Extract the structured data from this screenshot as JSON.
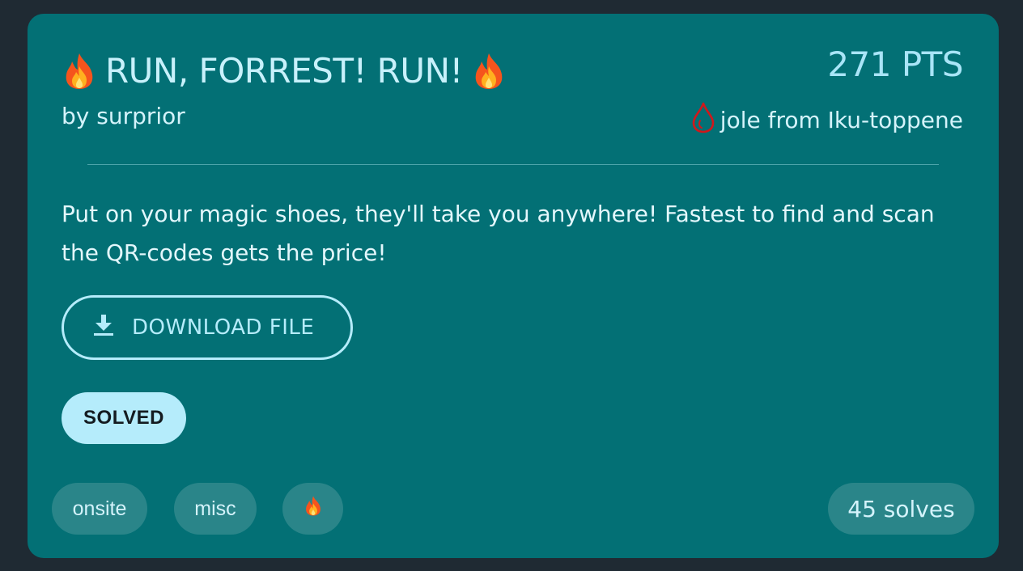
{
  "challenge": {
    "title": "RUN, FORREST! RUN!",
    "title_icon": "fire-icon",
    "author": "by surprior",
    "points": "271 PTS",
    "first_blood": {
      "icon": "blood-drop-icon",
      "text": "jole from Iku-toppene"
    },
    "description": "Put on your magic shoes, they'll take you anywhere! Fastest to find and scan the QR-codes gets the price!",
    "download_label": "DOWNLOAD FILE",
    "status_badge": "SOLVED",
    "tags": [
      {
        "label": "onsite"
      },
      {
        "label": "misc"
      },
      {
        "label": "",
        "icon": "fire-icon"
      }
    ],
    "solves": "45 solves"
  },
  "colors": {
    "page_background": "#1f2a33",
    "card_background": "#037075",
    "accent": "#b5ecfb",
    "blood_red": "#d0181b"
  }
}
